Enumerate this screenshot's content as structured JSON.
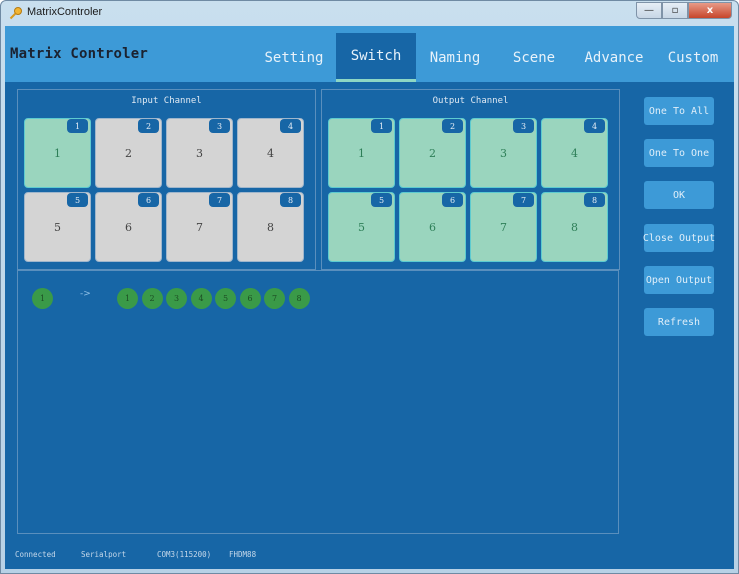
{
  "window": {
    "title": "MatrixControler",
    "controls": {
      "minimize": "—",
      "maximize": "▫",
      "close": "x"
    }
  },
  "header": {
    "app_title": "Matrix Controler",
    "tabs": [
      {
        "label": "Setting",
        "active": false
      },
      {
        "label": "Switch",
        "active": true
      },
      {
        "label": "Naming",
        "active": false
      },
      {
        "label": "Scene",
        "active": false
      },
      {
        "label": "Advance",
        "active": false
      },
      {
        "label": "Custom",
        "active": false
      }
    ]
  },
  "input_panel": {
    "title": "Input Channel",
    "channels": [
      {
        "badge": "1",
        "label": "1",
        "selected": true
      },
      {
        "badge": "2",
        "label": "2",
        "selected": false
      },
      {
        "badge": "3",
        "label": "3",
        "selected": false
      },
      {
        "badge": "4",
        "label": "4",
        "selected": false
      },
      {
        "badge": "5",
        "label": "5",
        "selected": false
      },
      {
        "badge": "6",
        "label": "6",
        "selected": false
      },
      {
        "badge": "7",
        "label": "7",
        "selected": false
      },
      {
        "badge": "8",
        "label": "8",
        "selected": false
      }
    ]
  },
  "output_panel": {
    "title": "Output Channel",
    "channels": [
      {
        "badge": "1",
        "label": "1",
        "selected": true
      },
      {
        "badge": "2",
        "label": "2",
        "selected": true
      },
      {
        "badge": "3",
        "label": "3",
        "selected": true
      },
      {
        "badge": "4",
        "label": "4",
        "selected": true
      },
      {
        "badge": "5",
        "label": "5",
        "selected": true
      },
      {
        "badge": "6",
        "label": "6",
        "selected": true
      },
      {
        "badge": "7",
        "label": "7",
        "selected": true
      },
      {
        "badge": "8",
        "label": "8",
        "selected": true
      }
    ]
  },
  "actions": [
    {
      "label": "One To All"
    },
    {
      "label": "One To One"
    },
    {
      "label": "OK"
    },
    {
      "label": "Close Output"
    },
    {
      "label": "Open Output"
    },
    {
      "label": "Refresh"
    }
  ],
  "routing": {
    "source": "1",
    "arrow": "->",
    "targets": [
      "1",
      "2",
      "3",
      "4",
      "5",
      "6",
      "7",
      "8"
    ]
  },
  "status_bar": {
    "connection": "Connected",
    "port_type": "Serialport",
    "port": "COM3(115200)",
    "device": "FHDM88"
  },
  "colors": {
    "header": "#3d9ad7",
    "body": "#1766a6",
    "selected_cell": "#9ad5be",
    "idle_cell": "#d4d4d4",
    "route_dot": "#3a9a48"
  }
}
